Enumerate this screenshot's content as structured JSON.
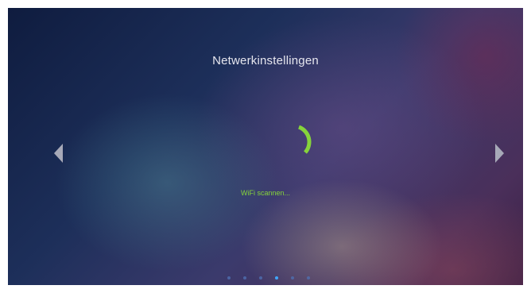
{
  "screen": {
    "title": "Netwerkinstellingen",
    "status_text": "WiFi scannen...",
    "accent_color": "#86d43b",
    "background_style": "blurred purple-blue gradient"
  },
  "navigation": {
    "left_icon": "chevron-left-icon",
    "right_icon": "chevron-right-icon"
  },
  "spinner": {
    "icon": "loading-spinner-icon",
    "color": "#86d43b"
  },
  "pager": {
    "total_pages": 6,
    "active_index": 3,
    "inactive_color": "#4f6fb0",
    "active_color": "#3fa7ff"
  }
}
